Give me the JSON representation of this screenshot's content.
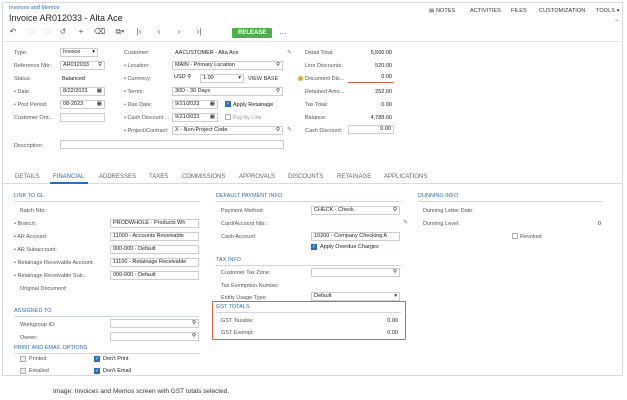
{
  "breadcrumb": "Invoices and Memos",
  "page_title": "Invoice AR012033 - Alta Ace",
  "top_menu": [
    "NOTES",
    "ACTIVITIES",
    "FILES",
    "CUSTOMIZATION",
    "TOOLS"
  ],
  "toolbar": {
    "release_label": "RELEASE",
    "more_label": "···"
  },
  "summary": {
    "type_label": "Type:",
    "type_value": "Invoice",
    "refnbr_label": "Reference Nbr.:",
    "refnbr_value": "AR012033",
    "status_label": "Status:",
    "status_value": "Balanced",
    "date_label": "• Date:",
    "date_value": "8/22/2023",
    "post_label": "• Post Period:",
    "post_value": "08-2023",
    "custord_label": "Customer Ord...",
    "customer_label": "Customer:",
    "customer_value": "AACUSTOMER - Alta Ace",
    "location_label": "• Location:",
    "location_value": "MAIN - Primary Location",
    "currency_label": "• Currency:",
    "currency_value": "USD",
    "rate_value": "1.00",
    "viewbase_label": "VIEW BASE",
    "terms_label": "• Terms:",
    "terms_value": "30D - 30 Days",
    "duedate_label": "• Due Date:",
    "duedate_value": "9/21/2023",
    "applyret_label": "Apply Retainage",
    "cashdisc_label": "• Cash Discount ...",
    "cashdisc_value": "9/21/2023",
    "paybyline_label": "Pay by Line",
    "project_label": "• Project/Contract:",
    "project_value": "X - Non-Project Code.",
    "description_label": "Description:",
    "detail_total_label": "Detail Total:",
    "detail_total_value": "5,560.00",
    "line_discounts_label": "Line Discounts:",
    "line_discounts_value": "520.00",
    "document_dis_label": "Document Dis...",
    "document_dis_value": "0.00",
    "retained_label": "Retained Amo...",
    "retained_value": "252.00",
    "taxtotal_label": "Tax Total:",
    "taxtotal_value": "0.00",
    "balance_label": "Balance:",
    "balance_value": "4,788.00",
    "cashdiscount_label": "Cash Discount:",
    "cashdiscount_value": "0.00"
  },
  "tabs": [
    "DETAILS",
    "FINANCIAL",
    "ADDRESSES",
    "TAXES",
    "COMMISSIONS",
    "APPROVALS",
    "DISCOUNTS",
    "RETAINAGE",
    "APPLICATIONS"
  ],
  "link_gl": {
    "title": "LINK TO GL",
    "batch_label": "Batch Nbr.:",
    "branch_label": "• Branch:",
    "branch_value": "PRODWHOLE - Products Wh",
    "ar_account_label": "• AR Account:",
    "ar_account_value": "11000 - Accounts Receivable",
    "ar_sub_label": "• AR Subaccount:",
    "ar_sub_value": "000-000 - Default",
    "ret_acct_label": "• Retainage Receivable Account:",
    "ret_acct_value": "11100 - Retainage Receivable",
    "ret_sub_label": "• Retainage Receivable Sub.:",
    "ret_sub_value": "000-000 - Default",
    "orig_doc_label": "Original Document:"
  },
  "assigned": {
    "title": "ASSIGNED TO",
    "workgroup_label": "Workgroup ID:",
    "owner_label": "Owner:"
  },
  "print_email": {
    "title": "PRINT AND EMAIL OPTIONS",
    "printed_label": "Printed",
    "dont_print_label": "Don't Print",
    "emailed_label": "Emailed",
    "dont_email_label": "Don't Email"
  },
  "payment": {
    "title": "DEFAULT PAYMENT INFO",
    "method_label": "Payment Method:",
    "method_value": "CHECK - Check",
    "card_label": "Card/Account Nbr.:",
    "cash_label": "Cash Account:",
    "cash_value": "10200 - Company Checking A",
    "overdue_label": "Apply Overdue Charges"
  },
  "tax_info": {
    "title": "TAX INFO",
    "zone_label": "Customer Tax Zone:",
    "exemption_label": "Tax Exemption Number:",
    "entity_label": "Entity Usage Type:",
    "entity_value": "Default"
  },
  "gst": {
    "title": "GST TOTALS",
    "taxable_label": "GST Taxable:",
    "taxable_value": "0.00",
    "exempt_label": "GST Exempt:",
    "exempt_value": "0.00"
  },
  "dunning": {
    "title": "DUNNING INFO",
    "letter_date_label": "Dunning Letter Date:",
    "level_label": "Dunning Level:",
    "level_value": "0",
    "revoked_label": "Revoked"
  },
  "caption": "Image: Invoices and Memos screen with GST totals selected.",
  "colors": {
    "accent": "#2a6ebb",
    "release": "#4cae4c",
    "highlight": "#e06040"
  }
}
